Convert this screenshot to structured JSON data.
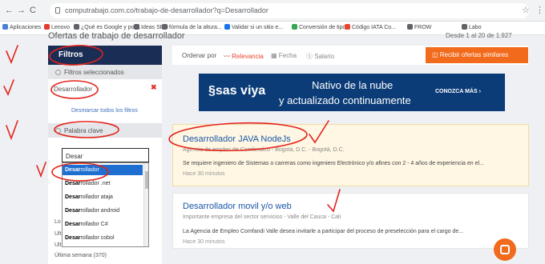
{
  "browser": {
    "url": "computrabajo.com.co/trabajo-de-desarrollador?q=Desarrollador",
    "nav": {
      "back": "←",
      "forward": "→",
      "reload": "C"
    },
    "bookmarks": [
      {
        "label": "Aplicaciones",
        "color": "#4a7fd6"
      },
      {
        "label": "Lenovo",
        "color": "#e23b2e"
      },
      {
        "label": "¿Qué es Google y por...",
        "color": "#5f6368"
      },
      {
        "label": "Ideas SEO",
        "color": "#5f6368"
      },
      {
        "label": "fórmula de la altura...",
        "color": "#5f6368"
      },
      {
        "label": "Validar si un sitio e...",
        "color": "#1a73e8"
      },
      {
        "label": "Conversión de tipo...",
        "color": "#34a853"
      },
      {
        "label": "Código IATA Co...",
        "color": "#e8432f"
      },
      {
        "label": "FROW",
        "color": "#5f6368"
      },
      {
        "label": "Labo",
        "color": "#5f6368"
      }
    ]
  },
  "page": {
    "heading_partial": "Ofertas de trabajo de desarrollador",
    "sort_right_partial": "Desde 1 al 20 de 1.927"
  },
  "sidebar": {
    "title": "Filtros",
    "selected_filters_label": "Filtros seleccionados",
    "active_filter": "Desarrollador",
    "remove_icon": "✖",
    "clear_filters": "Desmarcar todos los filtros",
    "keyword_label": "Palabra clave",
    "keyword_value": "Desar",
    "suggestions": [
      {
        "bold": "Desar",
        "rest": "rollador"
      },
      {
        "bold": "Desar",
        "rest": "rollador .net"
      },
      {
        "bold": "Desar",
        "rest": "rollador ataja"
      },
      {
        "bold": "Desar",
        "rest": "rollador android"
      },
      {
        "bold": "Desar",
        "rest": "rollador C#"
      },
      {
        "bold": "Desar",
        "rest": "rollador cobol"
      }
    ],
    "below_items": [
      "Lo",
      "Ult",
      "Ult",
      "Última semana (370)"
    ]
  },
  "sortbar": {
    "label": "Ordenar por",
    "options": [
      "Relevancia",
      "Fecha",
      "Salario"
    ],
    "alert_button": "Recibir ofertas similares"
  },
  "ad": {
    "logo": "sas viya",
    "line1": "Nativo de la nube",
    "line2": "y actualizado continuamente",
    "cta": "CONOZCA MÁS ›"
  },
  "jobs": [
    {
      "title": "Desarrollador JAVA NodeJs",
      "company": "Agencia de empleo de Comfenalco",
      "location": "Bogotá, D.C. - Bogotá, D.C.",
      "description": "Se requiere ingeniero de Sistemas o carreras como ingeniero Electrónico y/o afines con 2 - 4 años de experiencia en el...",
      "time": "Hace 30 minutos"
    },
    {
      "title": "Desarrollador movil y/o web",
      "company": "Importante empresa del sector servicios",
      "location": "Valle del Cauca - Cali",
      "description": "La Agencia de Empleo Comfandi Valle desea invitarle a participar del proceso de preselección para el cargo de...",
      "time": "Hace 30 minutos"
    }
  ],
  "colors": {
    "sidebar_header": "#1a2d55",
    "accent_orange": "#f26a1b",
    "annotation_red": "#e3221a",
    "link_blue": "#1a56a8",
    "highlight_bg": "#fff7e3",
    "selected_blue": "#1f6fd1"
  },
  "icons": {
    "sort_relevance": "chart-trend-icon",
    "sort_date": "calendar-icon",
    "sort_salary": "money-icon",
    "alert": "bell-icon",
    "fab": "chat-icon"
  }
}
